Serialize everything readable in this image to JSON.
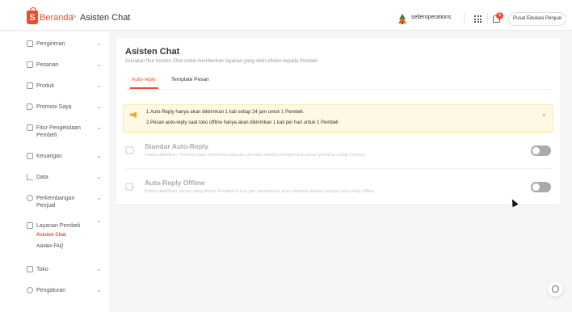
{
  "header": {
    "breadcrumb_home": "Beranda",
    "breadcrumb_separator": ">",
    "breadcrumb_current": "Asisten Chat",
    "username": "selleroperations",
    "notification_count": "5",
    "edu_button": "Pusat Edukasi Penjual",
    "logo_letter": "S"
  },
  "sidebar": {
    "items": [
      {
        "label": "Pengiriman",
        "icon": "truck-icon"
      },
      {
        "label": "Pesanan",
        "icon": "clipboard-icon"
      },
      {
        "label": "Produk",
        "icon": "box-icon"
      },
      {
        "label": "Promosi Saya",
        "icon": "tag-icon"
      },
      {
        "label": "Fitur Pengelolaan",
        "label2": "Pembeli",
        "icon": "people-icon"
      },
      {
        "label": "Keuangan",
        "icon": "wallet-icon"
      },
      {
        "label": "Data",
        "icon": "chart-icon"
      },
      {
        "label": "Perkembangan",
        "label2": "Penjual",
        "icon": "growth-icon"
      },
      {
        "label": "Layanan Pembeli",
        "icon": "headset-icon"
      },
      {
        "label": "Toko",
        "icon": "store-icon"
      },
      {
        "label": "Pengaturan",
        "icon": "gear-icon"
      }
    ],
    "subitems": [
      {
        "label": "Asisten Chat",
        "active": true
      },
      {
        "label": "Asisten FAQ",
        "active": false
      }
    ]
  },
  "main": {
    "title": "Asisten Chat",
    "description": "Gunakan fitur Asisten Chat untuk memberikan layanan yang lebih efisien kepada Pembeli.",
    "tabs": [
      {
        "label": "Auto-reply",
        "active": true
      },
      {
        "label": "Template Pesan",
        "active": false
      }
    ],
    "notice": {
      "line1": "1.Auto-Reply hanya akan dikirimkan 1 kali setiap 24 jam untuk 1 Pembeli.",
      "line2": "2.Pesan auto-reply saat toko offline hanya akan dikirimkan 1 kali per hari untuk 1 Pembeli",
      "close": "×"
    },
    "settings": [
      {
        "title": "Standar Auto-Reply",
        "description": "Ketika diaktifkan, Pembeli akan menerima balasan otomatis setelah mengirimkan pesan pertama setiap harinya.",
        "enabled": false
      },
      {
        "title": "Auto-Reply Offline",
        "description": "Ketika diaktifkan, pesan yang dikirim Pembeli di luar jam operasional akan otomatis dibalas dengan auto-reply offline.",
        "enabled": false
      }
    ]
  },
  "colors": {
    "accent": "#ee4d2d",
    "notice_bg": "#fff8e4",
    "toggle_off": "#aaaaaa"
  }
}
